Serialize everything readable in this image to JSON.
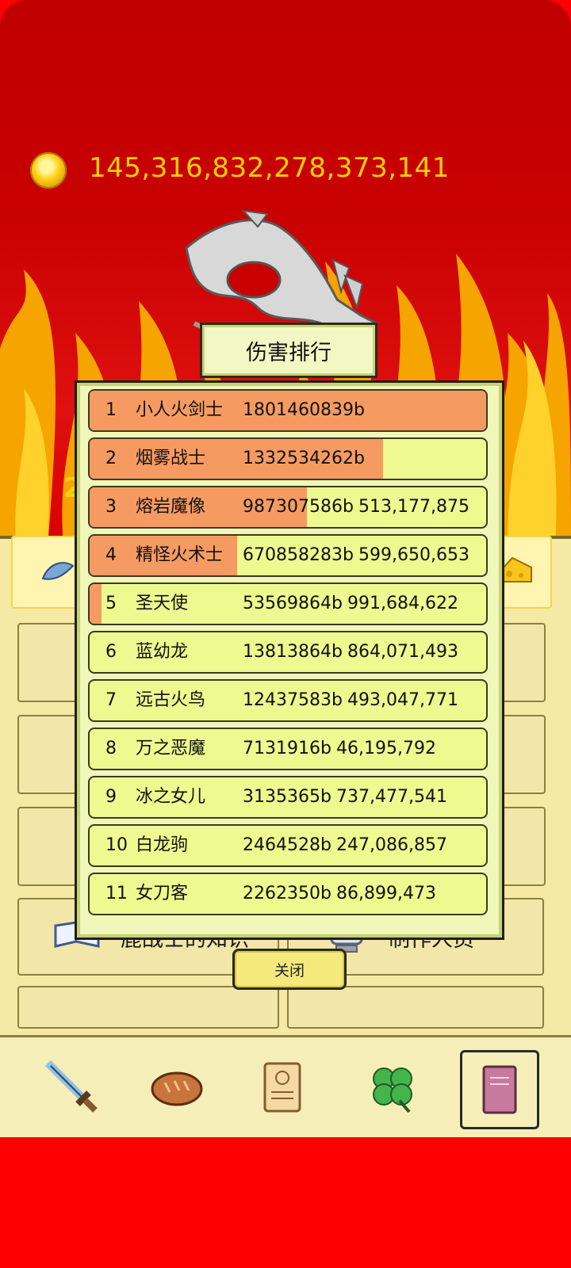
{
  "gold": {
    "amount": "145,316,832,278,373,141"
  },
  "modal": {
    "title": "伤害排行",
    "close_label": "关闭",
    "rows": [
      {
        "rank": "1",
        "name": "小人火剑士",
        "damage": "1801460839b",
        "value": "",
        "bar": 1.0
      },
      {
        "rank": "2",
        "name": "烟雾战士",
        "damage": "1332534262b",
        "value": "",
        "bar": 0.74
      },
      {
        "rank": "3",
        "name": "熔岩魔像",
        "damage": "987307586b",
        "value": "513,177,875",
        "bar": 0.548
      },
      {
        "rank": "4",
        "name": "精怪火术士",
        "damage": "670858283b",
        "value": "599,650,653",
        "bar": 0.372
      },
      {
        "rank": "5",
        "name": "圣天使",
        "damage": "53569864b",
        "value": "991,684,622",
        "bar": 0.03
      },
      {
        "rank": "6",
        "name": "蓝幼龙",
        "damage": "13813864b",
        "value": "864,071,493",
        "bar": 0.0
      },
      {
        "rank": "7",
        "name": "远古火鸟",
        "damage": "12437583b",
        "value": "493,047,771",
        "bar": 0.0
      },
      {
        "rank": "8",
        "name": "万之恶魔",
        "damage": "7131916b",
        "value": "46,195,792",
        "bar": 0.0
      },
      {
        "rank": "9",
        "name": "冰之女儿",
        "damage": "3135365b",
        "value": "737,477,541",
        "bar": 0.0
      },
      {
        "rank": "10",
        "name": "白龙驹",
        "damage": "2464528b",
        "value": "247,086,857",
        "bar": 0.0
      },
      {
        "rank": "11",
        "name": "女刀客",
        "damage": "2262350b",
        "value": "86,899,473",
        "bar": 0.0
      }
    ]
  },
  "background_menu": {
    "left_tile_label": "鹿战士的知识",
    "right_tile_label": "制作人员"
  },
  "bottom_nav": {
    "items": [
      {
        "id": "weapon",
        "icon": "sword-icon"
      },
      {
        "id": "food",
        "icon": "bread-icon"
      },
      {
        "id": "scroll",
        "icon": "scroll-icon"
      },
      {
        "id": "luck",
        "icon": "clover-icon"
      },
      {
        "id": "book",
        "icon": "book-icon",
        "active": true
      }
    ]
  },
  "colors": {
    "background_red": "#ff0000",
    "bar_fill": "#f59b62",
    "row_bg": "#eef98f",
    "gold_text": "#ffd200"
  }
}
